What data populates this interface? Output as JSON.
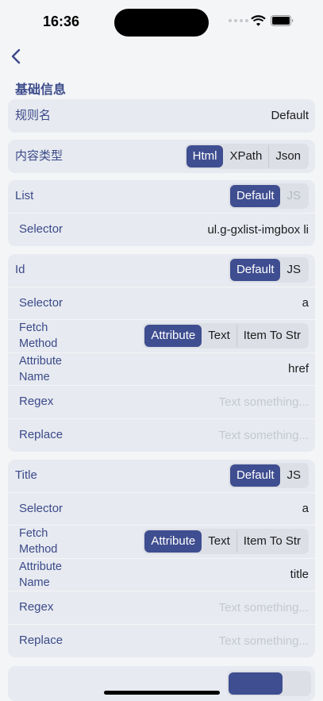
{
  "status": {
    "time": "16:36"
  },
  "section_title": "基础信息",
  "rule_name": {
    "label": "规则名",
    "value": "Default"
  },
  "content_type": {
    "label": "内容类型",
    "options": [
      "Html",
      "XPath",
      "Json"
    ],
    "selected": "Html"
  },
  "list": {
    "label": "List",
    "mode": {
      "options": [
        "Default",
        "JS"
      ],
      "selected": "Default",
      "disabled": "JS"
    },
    "selector": {
      "label": "Selector",
      "value": "ul.g-gxlist-imgbox li"
    }
  },
  "id": {
    "label": "Id",
    "mode": {
      "options": [
        "Default",
        "JS"
      ],
      "selected": "Default"
    },
    "selector": {
      "label": "Selector",
      "value": "a"
    },
    "fetch_method": {
      "label": "Fetch Method",
      "options": [
        "Attribute",
        "Text",
        "Item To Str"
      ],
      "selected": "Attribute"
    },
    "attribute_name": {
      "label": "Attribute Name",
      "value": "href"
    },
    "regex": {
      "label": "Regex",
      "placeholder": "Text something..."
    },
    "replace": {
      "label": "Replace",
      "placeholder": "Text something..."
    }
  },
  "title": {
    "label": "Title",
    "mode": {
      "options": [
        "Default",
        "JS"
      ],
      "selected": "Default"
    },
    "selector": {
      "label": "Selector",
      "value": "a"
    },
    "fetch_method": {
      "label": "Fetch Method",
      "options": [
        "Attribute",
        "Text",
        "Item To Str"
      ],
      "selected": "Attribute"
    },
    "attribute_name": {
      "label": "Attribute Name",
      "value": "title"
    },
    "regex": {
      "label": "Regex",
      "placeholder": "Text something..."
    },
    "replace": {
      "label": "Replace",
      "placeholder": "Text something..."
    }
  },
  "colors": {
    "accent": "#3f4e90",
    "label": "#3b4a8a",
    "card": "#e7eaf0",
    "background": "#f4f5f7"
  }
}
